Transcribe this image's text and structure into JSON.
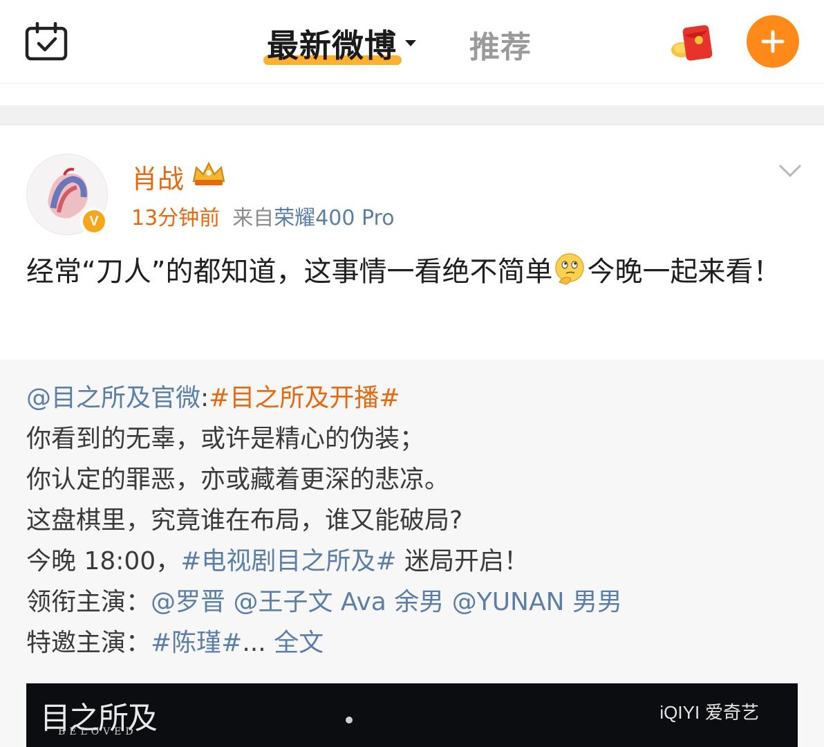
{
  "header": {
    "tab_latest": "最新微博",
    "tab_recommend": "推荐",
    "accent": "#ff8a1a",
    "underline_color": "#ffb02e",
    "icons": [
      "calendar-check-icon",
      "caret-down-icon",
      "red-packet-icon",
      "plus-icon"
    ]
  },
  "post": {
    "author": "肖战",
    "time": "13分钟前",
    "from_prefix": "来自",
    "device": "荣耀400 Pro",
    "verified_badge": "V",
    "text_part1": "经常“刀人”的都知道，这事情一看绝不简单",
    "text_part2": "今晚一起来看！",
    "icons": [
      "avatar",
      "verified-badge-icon",
      "crown-badge-icon",
      "chevron-down-icon",
      "thinking-emoji-icon"
    ]
  },
  "repost": {
    "mention_source": "@目之所及官微",
    "colon": ":",
    "topic_main": "#目之所及开播#",
    "line2": "你看到的无辜，或许是精心的伪装；",
    "line3": "你认定的罪恶，亦或藏着更深的悲凉。",
    "line4": "这盘棋里，究竟谁在布局，谁又能破局?",
    "line5_prefix": "今晚 18:00，",
    "line5_topic": "#电视剧目之所及#",
    "line5_suffix": " 迷局开启！",
    "line6_prefix": "领衔主演：",
    "line6_mention1": "@罗晋",
    "line6_mention2": "@王子文 Ava 余男",
    "line6_mention3": "@YUNAN 男男",
    "line7_prefix": "特邀主演：",
    "line7_topic": "#陈瑾#",
    "line7_ellipsis": "... ",
    "line7_fulltext": "全文"
  },
  "video": {
    "title": "目之所及",
    "subtitle": "BELOVED",
    "brand_logo": "iQIYI",
    "brand_name": "爱奇艺"
  }
}
